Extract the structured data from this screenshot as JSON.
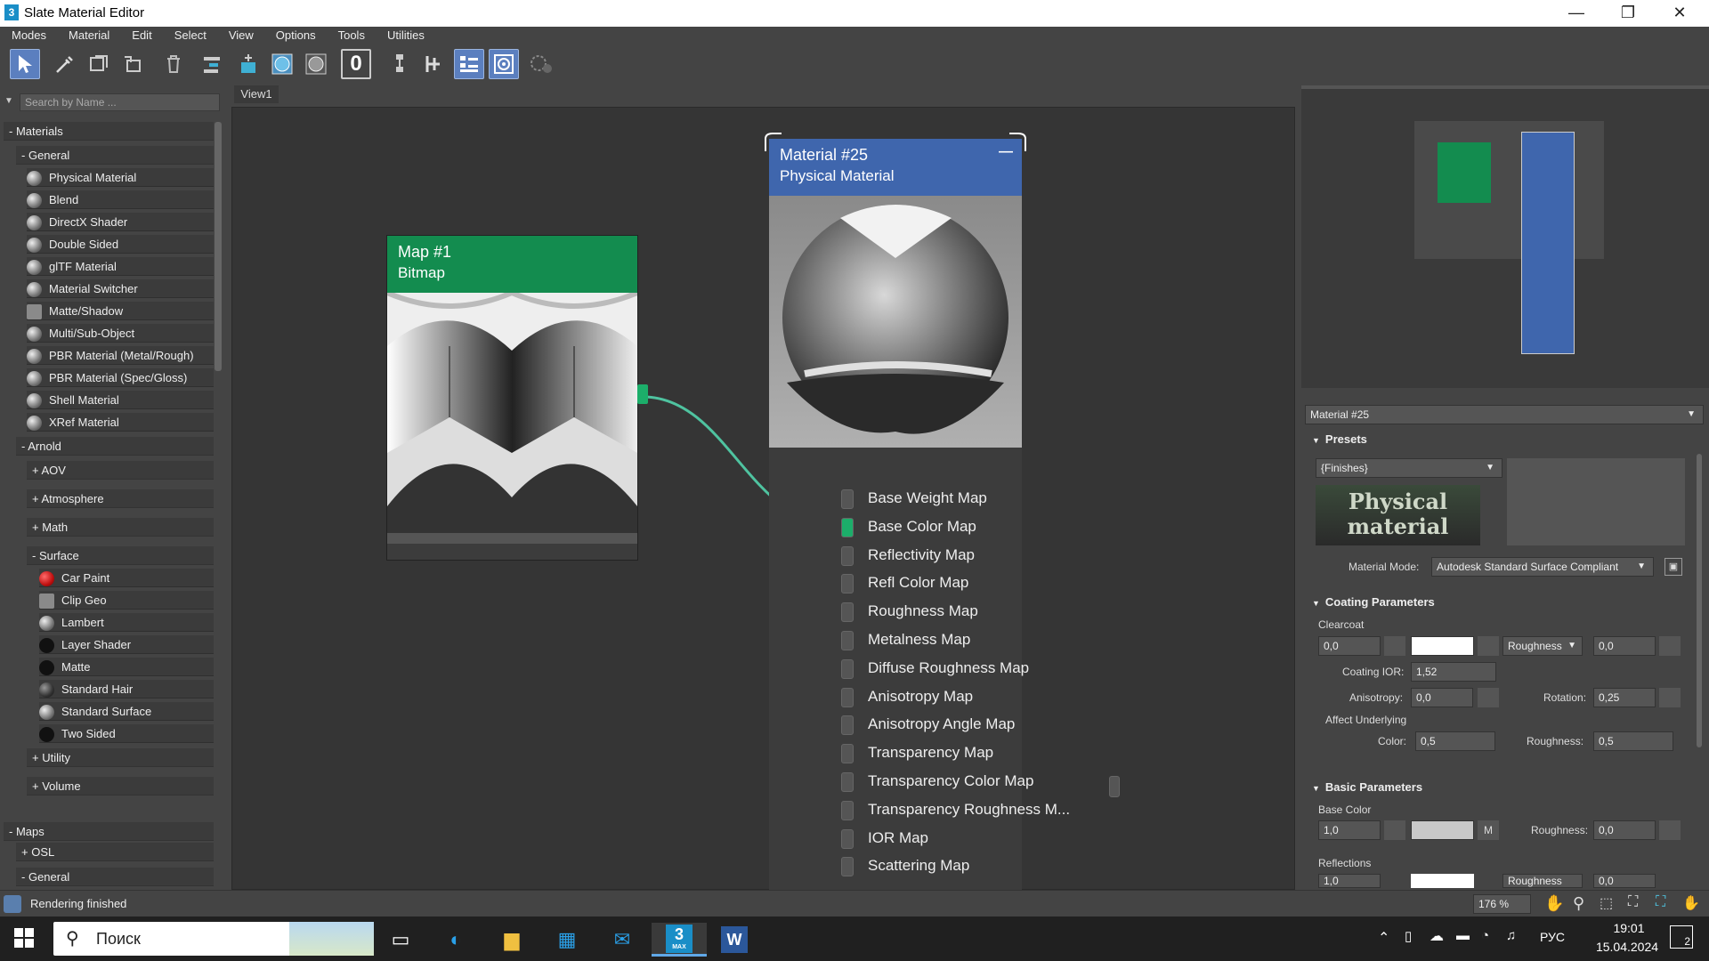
{
  "window": {
    "title": "Slate Material Editor",
    "app_icon": "3",
    "minimize": "—",
    "restore": "❐",
    "close": "✕"
  },
  "menu": [
    "Modes",
    "Material",
    "Edit",
    "Select",
    "View",
    "Options",
    "Tools",
    "Utilities"
  ],
  "search": {
    "placeholder": "Search by Name ..."
  },
  "browser": {
    "materials": "Materials",
    "general": "General",
    "general_items": [
      "Physical Material",
      "Blend",
      "DirectX Shader",
      "Double Sided",
      "glTF Material",
      "Material Switcher",
      "Matte/Shadow",
      "Multi/Sub-Object",
      "PBR Material (Metal/Rough)",
      "PBR Material (Spec/Gloss)",
      "Shell Material",
      "XRef Material"
    ],
    "arnold": "Arnold",
    "arnold_groups": [
      "AOV",
      "Atmosphere",
      "Math"
    ],
    "surface": "Surface",
    "surface_items": [
      "Car Paint",
      "Clip Geo",
      "Lambert",
      "Layer Shader",
      "Matte",
      "Standard Hair",
      "Standard Surface",
      "Two Sided"
    ],
    "arnold_groups2": [
      "Utility",
      "Volume"
    ],
    "maps": "Maps",
    "osl": "OSL",
    "maps_general": "General"
  },
  "view": {
    "tab": "View1"
  },
  "map_node": {
    "title": "Map #1",
    "subtitle": "Bitmap",
    "color": "#138c4f"
  },
  "material_node": {
    "title": "Material #25",
    "subtitle": "Physical Material",
    "color": "#3f66ad",
    "collapse": "—",
    "slots": [
      "Base Weight Map",
      "Base Color Map",
      "Reflectivity Map",
      "Refl Color Map",
      "Roughness Map",
      "Metalness Map",
      "Diffuse Roughness Map",
      "Anisotropy Map",
      "Anisotropy Angle Map",
      "Transparency Map",
      "Transparency Color Map",
      "Transparency Roughness M...",
      "IOR Map",
      "Scattering Map"
    ],
    "connected_slot": "Base Color Map"
  },
  "params": {
    "material_name": "Material #25",
    "presets": {
      "header": "Presets",
      "value": "{Finishes}",
      "logo_line1": "Physical",
      "logo_line2": "material",
      "mode_label": "Material Mode:",
      "mode_value": "Autodesk Standard Surface Compliant"
    },
    "coating": {
      "header": "Coating Parameters",
      "clearcoat": "Clearcoat",
      "clearcoat_value": "0,0",
      "roughness_dropdown": "Roughness",
      "roughness_value": "0,0",
      "ior_label": "Coating IOR:",
      "ior_value": "1,52",
      "aniso_label": "Anisotropy:",
      "aniso_value": "0,0",
      "rotation_label": "Rotation:",
      "rotation_value": "0,25",
      "affect": "Affect Underlying",
      "color_label": "Color:",
      "color_value": "0,5",
      "rough_label": "Roughness:",
      "rough_value": "0,5"
    },
    "basic": {
      "header": "Basic Parameters",
      "base_color": "Base Color",
      "base_value": "1,0",
      "m_button": "M",
      "rough_label": "Roughness:",
      "rough_value": "0,0",
      "reflections": "Reflections",
      "refl_value": "1,0",
      "refl_dropdown": "Roughness",
      "refl_rough_value": "0,0"
    }
  },
  "status": {
    "text": "Rendering finished",
    "zoom": "176 %"
  },
  "taskbar": {
    "search": "Поиск",
    "lang": "РУС",
    "time": "19:01",
    "date": "15.04.2024",
    "notif": "2",
    "max_label": "MAX"
  }
}
